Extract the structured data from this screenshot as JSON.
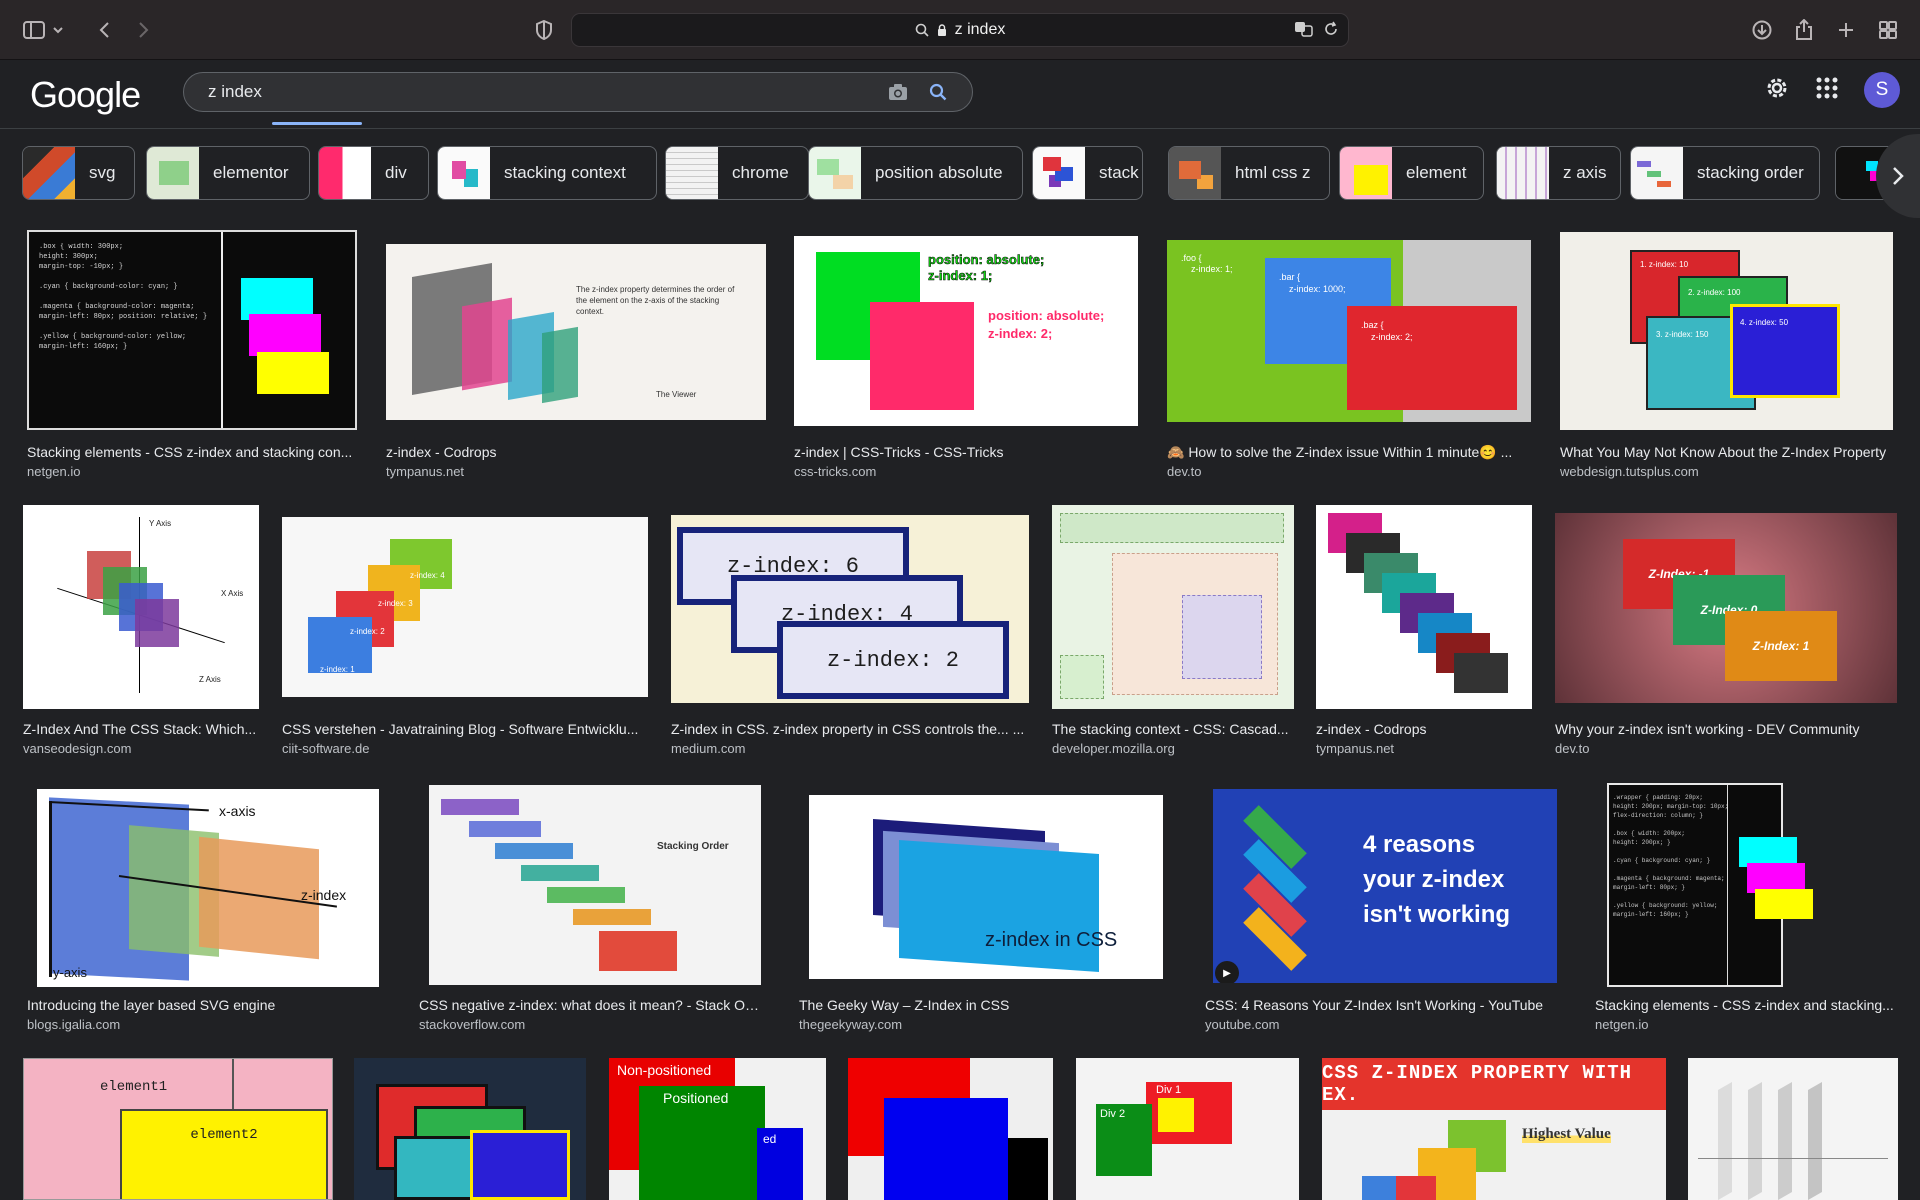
{
  "browser": {
    "address": "z index"
  },
  "google": {
    "logo": "Google",
    "query": "z index",
    "avatar": "S"
  },
  "chips": [
    {
      "label": "svg"
    },
    {
      "label": "elementor"
    },
    {
      "label": "div"
    },
    {
      "label": "stacking context"
    },
    {
      "label": "chrome"
    },
    {
      "label": "position absolute"
    },
    {
      "label": "stack"
    },
    {
      "label": "html css z"
    },
    {
      "label": "element"
    },
    {
      "label": "z axis"
    },
    {
      "label": "stacking order"
    }
  ],
  "results": [
    {
      "title": "Stacking elements - CSS z-index and stacking con...",
      "site": "netgen.io"
    },
    {
      "title": "z-index - Codrops",
      "site": "tympanus.net",
      "img_text": [
        "The z-index property determines the order of the element on the z-axis of the stacking context.",
        "The Viewer"
      ]
    },
    {
      "title": "z-index | CSS-Tricks - CSS-Tricks",
      "site": "css-tricks.com",
      "img_text": [
        "position: absolute;",
        "z-index: 1;",
        "position: absolute;",
        "z-index: 2;"
      ]
    },
    {
      "title": "🙈 How to solve the Z-index issue Within 1 minute😊 ...",
      "site": "dev.to",
      "img_text": [
        ".foo {",
        "z-index: 1;",
        ".bar {",
        "z-index: 1000;",
        ".baz {",
        "z-index: 2;"
      ]
    },
    {
      "title": "What You May Not Know About the Z-Index Property",
      "site": "webdesign.tutsplus.com",
      "img_text": [
        "1. z-index: 10",
        "2. z-index: 100",
        "3. z-index: 150",
        "4. z-index: 50"
      ]
    },
    {
      "title": "Z-Index And The CSS Stack: Which...",
      "site": "vanseodesign.com",
      "img_text": [
        "Y Axis",
        "X Axis",
        "Z Axis"
      ]
    },
    {
      "title": "CSS verstehen - Javatraining Blog - Software Entwicklu...",
      "site": "ciit-software.de",
      "img_text": [
        "z-index: 4",
        "z-index: 3",
        "z-index: 2",
        "z-index: 1"
      ]
    },
    {
      "title": "Z-index in CSS. z-index property in CSS controls the... ...",
      "site": "medium.com",
      "img_text": [
        "z-index: 6",
        "z-index: 4",
        "z-index: 2"
      ]
    },
    {
      "title": "The stacking context - CSS: Cascad...",
      "site": "developer.mozilla.org"
    },
    {
      "title": "z-index - Codrops",
      "site": "tympanus.net"
    },
    {
      "title": "Why your z-index isn't working - DEV Community",
      "site": "dev.to",
      "img_text": [
        "Z-Index: -1",
        "Z-Index: 0",
        "Z-Index: 1"
      ]
    },
    {
      "title": "Introducing the layer based SVG engine",
      "site": "blogs.igalia.com",
      "img_text": [
        "x-axis",
        "z-index",
        "y-axis"
      ]
    },
    {
      "title": "CSS negative z-index: what does it mean? - Stack Ove...",
      "site": "stackoverflow.com",
      "img_text": [
        "Stacking Order"
      ]
    },
    {
      "title": "The Geeky Way – Z-Index in CSS",
      "site": "thegeekyway.com",
      "img_text": [
        "z-index in CSS"
      ]
    },
    {
      "title": "CSS: 4 Reasons Your Z-Index Isn't Working - YouTube",
      "site": "youtube.com",
      "img_text": [
        "4 reasons",
        "your z-index",
        "isn't working"
      ]
    },
    {
      "title": "Stacking elements - CSS z-index and stacking...",
      "site": "netgen.io"
    }
  ],
  "bottom_row": {
    "img1": [
      "element1",
      "element2"
    ],
    "img3": [
      "Non-positioned",
      "Positioned"
    ],
    "img5": [
      "Div 1",
      "Div 2"
    ],
    "img6": [
      "CSS Z-INDEX PROPERTY WITH EX.",
      "Highest Value"
    ]
  }
}
